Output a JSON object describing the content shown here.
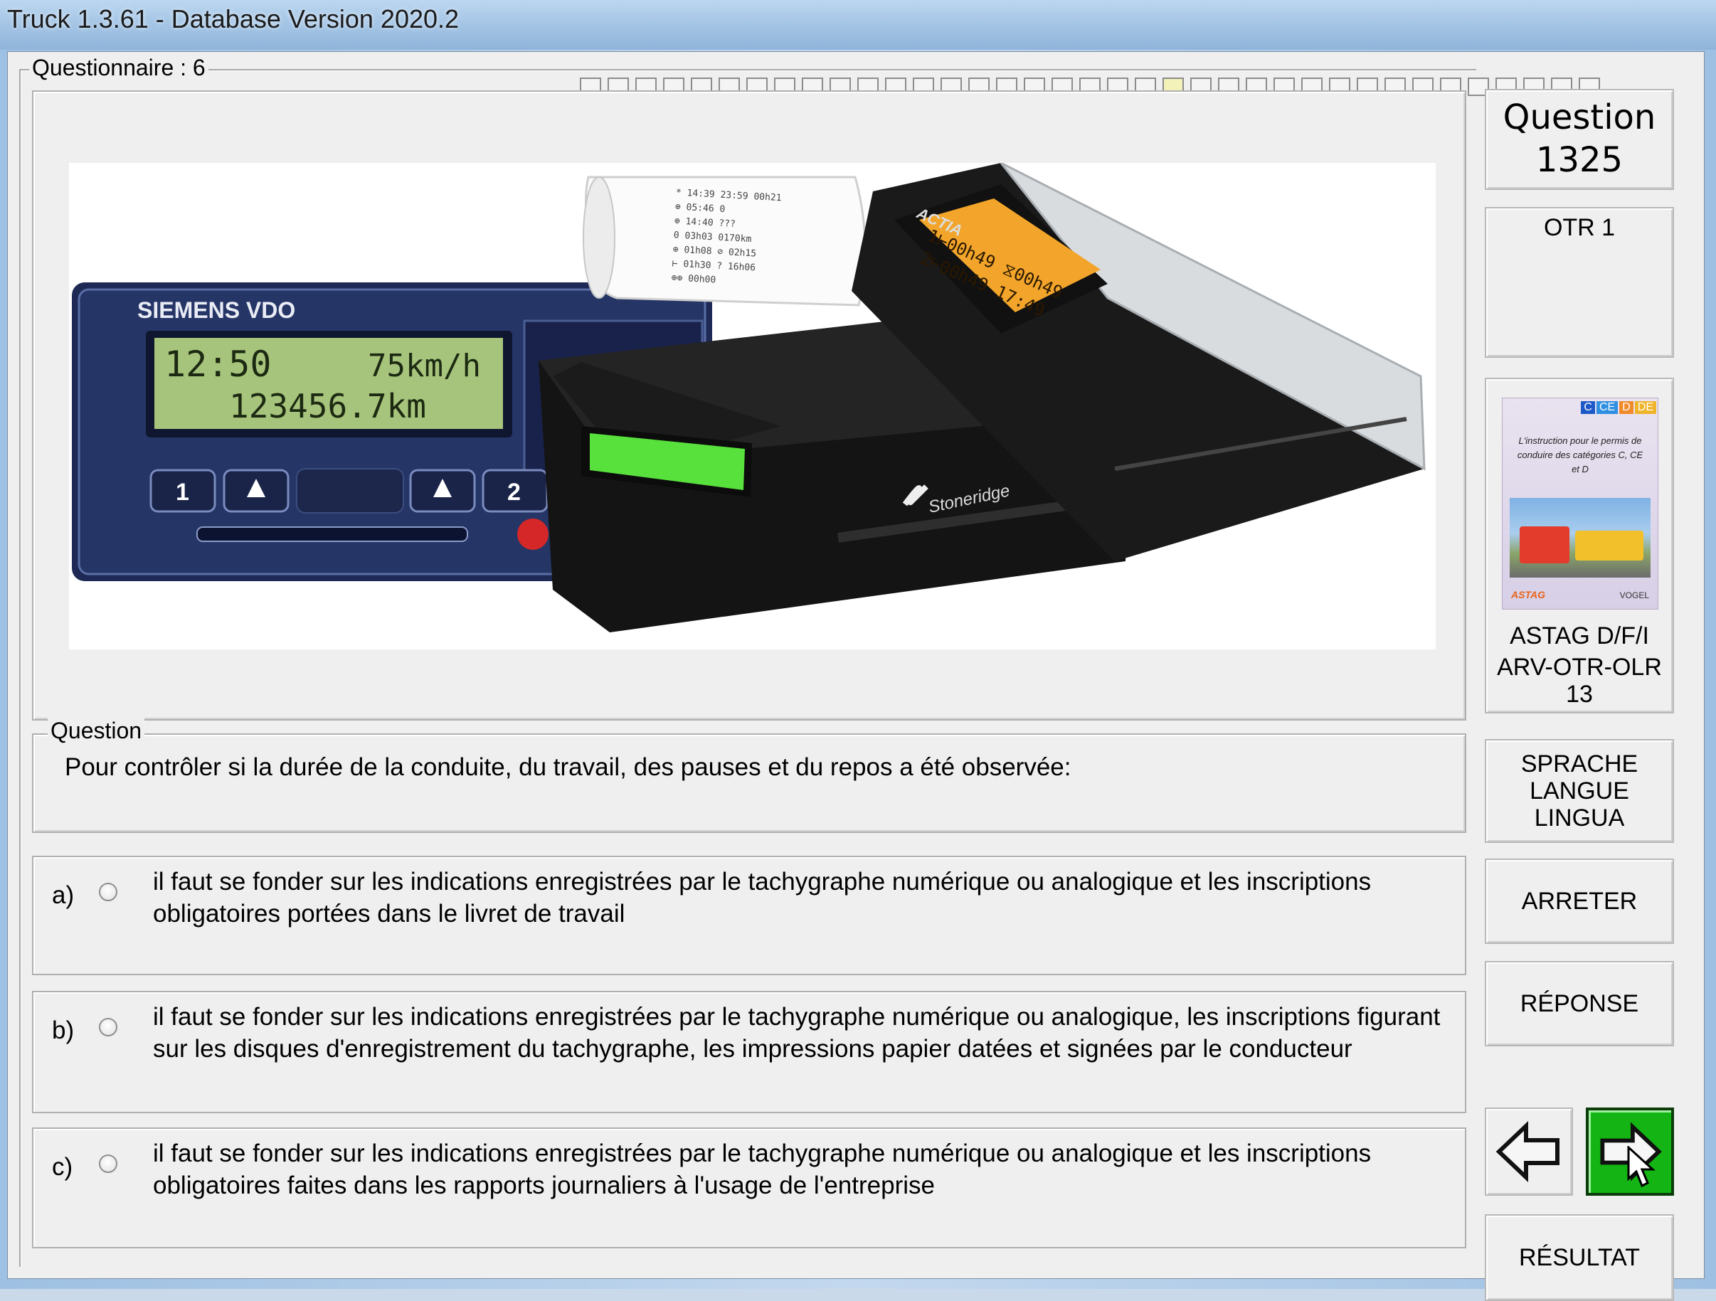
{
  "window": {
    "title": "Truck 1.3.61 - Database Version 2020.2"
  },
  "questionnaire": {
    "label": "Questionnaire : 6",
    "progress_total": 37,
    "progress_current": 22
  },
  "question_number": {
    "line1": "Question",
    "line2": "1325"
  },
  "category": "OTR 1",
  "book": {
    "cover_badges": [
      "C",
      "CE",
      "D",
      "DE"
    ],
    "cover_text": "L'instruction pour le permis de conduire des catégories C, CE et D",
    "cover_publishers": [
      "ASTAG",
      "VOGEL"
    ],
    "line1": "ASTAG D/F/I",
    "line2": "ARV-OTR-OLR",
    "line3": "13"
  },
  "image": {
    "vdo_brand": "SIEMENS VDO",
    "vdo_line1": "12:50",
    "vdo_speed": "75km/h",
    "vdo_line2": "123456.7km",
    "vdo_btn1": "1",
    "vdo_btn2": "2",
    "stoneridge_brand": "Stoneridge",
    "actia_brand": "ACTIA",
    "actia_line1": "1⊢00h49  ⧖00h49",
    "actia_line2": "2⊢00h49      17:49",
    "printout": [
      "* 14:39  23:59  00h21",
      "⊕ 05:46   0",
      "⊕ 14:40  ???",
      "0  03h03  0170km",
      "⊕ 01h08  ⊘ 02h15",
      "⊢ 01h30  ?  16h06",
      "⊕⊕ 00h00"
    ]
  },
  "question": {
    "legend": "Question",
    "text": "Pour contrôler si la durée de la conduite, du travail, des pauses et du repos a été observée:"
  },
  "answers": [
    {
      "letter": "a)",
      "text": "il faut se fonder sur les indications enregistrées par le tachygraphe numérique ou analogique et les inscriptions obligatoires portées dans le livret de travail"
    },
    {
      "letter": "b)",
      "text": "il faut se fonder sur les indications enregistrées par le tachygraphe numérique ou analogique, les inscriptions figurant sur les disques d'enregistrement du tachygraphe, les impressions papier datées et signées par le conducteur"
    },
    {
      "letter": "c)",
      "text": "il faut se fonder sur les indications enregistrées par le tachygraphe numérique ou analogique et les inscriptions obligatoires faites dans les rapports journaliers à l'usage de l'entreprise"
    }
  ],
  "buttons": {
    "language": "SPRACHE LANGUE LINGUA",
    "stop": "ARRETER",
    "answer": "RÉPONSE",
    "result": "RÉSULTAT"
  },
  "colors": {
    "next_button": "#13b413",
    "vdo_lcd": "#a7c47c",
    "stoneridge_lcd": "#58e03c",
    "actia_lcd": "#f2a52a"
  },
  "icons": {
    "prev": "arrow-left-icon",
    "next": "arrow-right-icon",
    "cursor": "mouse-pointer-icon"
  }
}
